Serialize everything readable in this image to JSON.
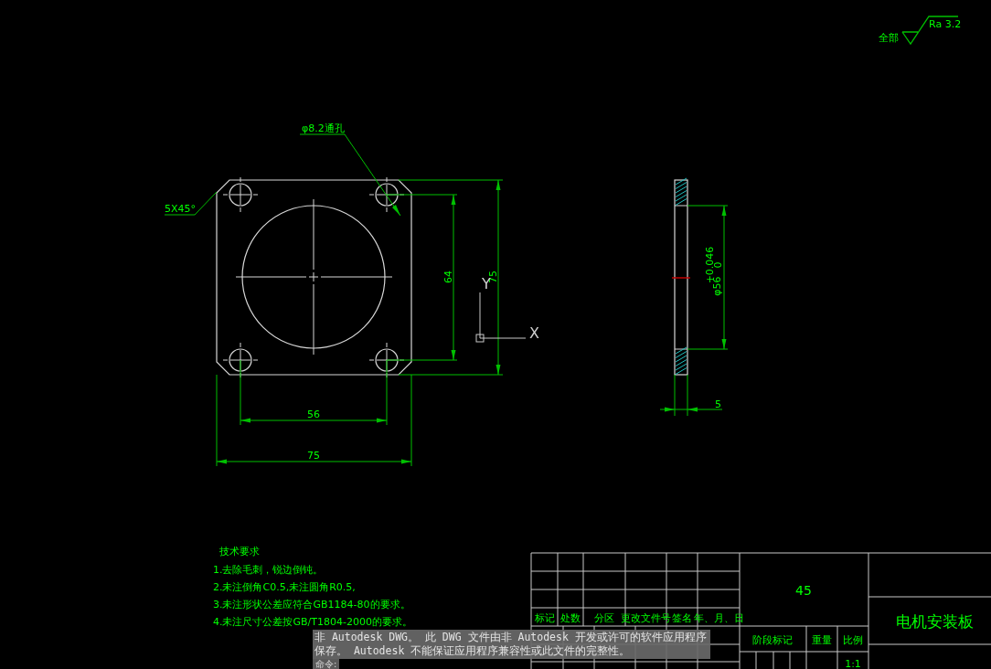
{
  "roughness": {
    "label": "全部",
    "value": "Ra 3.2"
  },
  "front_view": {
    "hole_note": "φ8.2通孔",
    "chamfer_note": "5X45°",
    "dims": [
      "64",
      "75",
      "56",
      "75"
    ]
  },
  "ucs": {
    "x": "X",
    "y": "Y"
  },
  "side_view": {
    "diameter": "φ56",
    "tol_upper": "+0.046",
    "tol_lower": "0",
    "thickness": "5"
  },
  "tech_requirements": {
    "title": "技术要求",
    "items": [
      "1.去除毛刺，锐边倒钝。",
      "2.未注倒角C0.5,未注圆角R0.5,",
      "3.未注形状公差应符合GB1184-80的要求。",
      "4.未注尺寸公差按GB/T1804-2000的要求。"
    ]
  },
  "title_block": {
    "headers": [
      "标记",
      "处数",
      "分区",
      "更改文件号",
      "签名",
      "年、月、日"
    ],
    "material": "45",
    "stage_header": "阶段标记",
    "weight_header": "重量",
    "scale_header": "比例",
    "scale": "1:1",
    "part_name": "电机安装板"
  },
  "notice": {
    "lines": [
      "非 Autodesk DWG。  此 DWG 文件由非 Autodesk 开发或许可的软件应用程序",
      "保存。  Autodesk 不能保证应用程序兼容性或此文件的完整性。"
    ]
  },
  "command": {
    "prompt": "命令:"
  }
}
